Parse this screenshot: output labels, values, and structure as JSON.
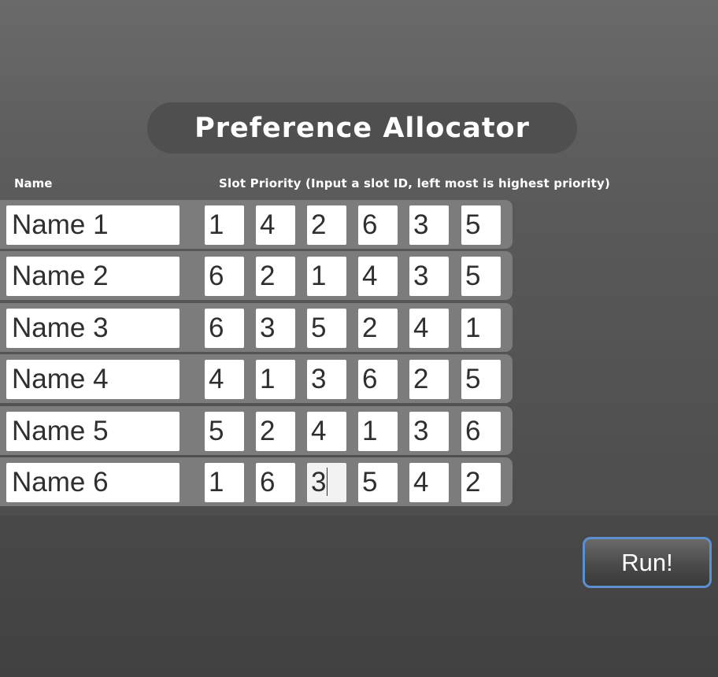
{
  "title": "Preference Allocator",
  "headers": {
    "name": "Name",
    "slot_priority": "Slot Priority (Input a slot ID, left most is highest priority)"
  },
  "rows": [
    {
      "name": "Name 1",
      "slots": [
        "1",
        "4",
        "2",
        "6",
        "3",
        "5"
      ]
    },
    {
      "name": "Name 2",
      "slots": [
        "6",
        "2",
        "1",
        "4",
        "3",
        "5"
      ]
    },
    {
      "name": "Name 3",
      "slots": [
        "6",
        "3",
        "5",
        "2",
        "4",
        "1"
      ]
    },
    {
      "name": "Name 4",
      "slots": [
        "4",
        "1",
        "3",
        "6",
        "2",
        "5"
      ]
    },
    {
      "name": "Name 5",
      "slots": [
        "5",
        "2",
        "4",
        "1",
        "3",
        "6"
      ]
    },
    {
      "name": "Name 6",
      "slots": [
        "1",
        "6",
        "3",
        "5",
        "4",
        "2"
      ]
    }
  ],
  "run_button": {
    "label": "Run!"
  },
  "colors": {
    "accent_border": "#5b8fd0",
    "title_pill": "#4f4f4f",
    "row_bg": "#7c7c7c",
    "field_bg": "#ffffff"
  }
}
